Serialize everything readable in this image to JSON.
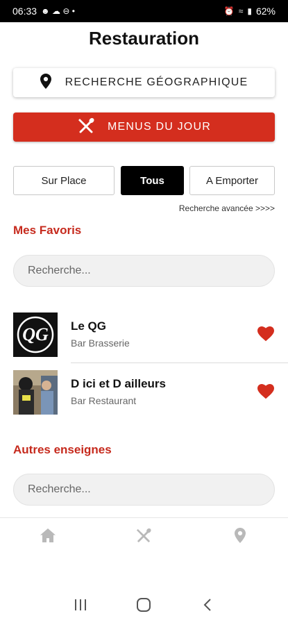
{
  "status_bar": {
    "time": "06:33",
    "battery": "62%"
  },
  "title": "Restauration",
  "geo_search": {
    "label": "RECHERCHE GÉOGRAPHIQUE",
    "icon": "map-pin-icon"
  },
  "menus_button": {
    "label": "MENUS DU JOUR",
    "icon": "fork-knife-icon",
    "color": "#d42e1e"
  },
  "filters": {
    "options": [
      "Sur Place",
      "Tous",
      "A Emporter"
    ],
    "selected": "Tous"
  },
  "advanced_search": "Recherche avancée  >>>>",
  "favorites": {
    "title": "Mes Favoris",
    "search_placeholder": "Recherche...",
    "items": [
      {
        "name": "Le QG",
        "type": "Bar Brasserie",
        "favorite": true,
        "logo_text": "QG"
      },
      {
        "name": "D ici et D ailleurs",
        "type": "Bar Restaurant",
        "favorite": true
      }
    ]
  },
  "others": {
    "title": "Autres enseignes",
    "search_placeholder": "Recherche..."
  },
  "bottom_nav": {
    "items": [
      "home-icon",
      "fork-knife-icon",
      "map-pin-icon"
    ]
  },
  "system_nav": [
    "recents-icon",
    "home-circle-icon",
    "back-icon"
  ],
  "colors": {
    "accent": "#d42e1e",
    "heading_red": "#c62a1d",
    "active_filter": "#000000"
  }
}
